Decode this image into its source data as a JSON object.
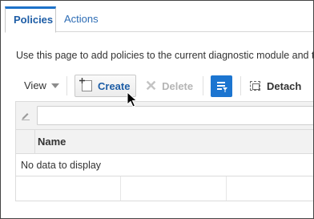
{
  "tabs": [
    {
      "label": "Policies",
      "active": true
    },
    {
      "label": "Actions",
      "active": false
    }
  ],
  "description": "Use this page to add policies to the current diagnostic module and to",
  "toolbar": {
    "view_label": "View",
    "create_label": "Create",
    "delete_label": "Delete",
    "detach_label": "Detach"
  },
  "table": {
    "filter_value": "",
    "columns": [
      "Name"
    ],
    "empty_message": "No data to display"
  },
  "colors": {
    "accent": "#1c75d0",
    "tab_active_text": "#1d5da6",
    "disabled_text": "#b5b5b5"
  }
}
